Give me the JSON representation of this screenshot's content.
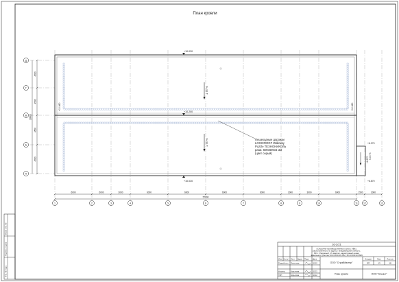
{
  "title": "План кровли",
  "columns": [
    "1",
    "2",
    "3",
    "4",
    "5",
    "6",
    "7",
    "8",
    "9",
    "10",
    "11",
    "12",
    "13"
  ],
  "rows": [
    "Д",
    "Г",
    "В",
    "Б",
    "А"
  ],
  "bay_dims": [
    "6000",
    "6000",
    "3000",
    "6000",
    "6000",
    "6000",
    "6000",
    "3000",
    "3000",
    "6000",
    "1500",
    "3000"
  ],
  "overall_length": "57000",
  "row_dims": [
    "4500",
    "4500",
    "4500",
    "4500"
  ],
  "overall_width": "18000",
  "levels": {
    "top_ridge": "+10.030",
    "mid_ridge": "+10.200",
    "bottom_eave": "+10.030",
    "left_mid": "+10.660",
    "right_mid": "+10.660",
    "annex_top": "+6.270",
    "annex_right": "+6.270",
    "annex_bottom": "+6.870"
  },
  "slopes": {
    "upper": "1.75 %",
    "lower": "1.75 %",
    "annex": "5.00 %"
  },
  "note_lines": [
    "Пешеходные дорожки",
    "LOGICROOF Walkway",
    "Puzzle ТЕХНОНИКОЛЬ",
    "разм. 600х600х6 мм",
    "(цвет серый)"
  ],
  "title_block": {
    "code": "16-2/21",
    "description_lines": [
      "«Сборочно-производственного цеха с АБК»,",
      "расположенного по адресу: Владимирская область,",
      "МО г. Радужный, 17 квартал, кадастровый номер",
      "земельного участка 33:23:000101:652, 33:23:000101:689"
    ],
    "header": [
      "Изм.",
      "Кол.уч",
      "Лист",
      "№док.",
      "Подп.",
      "Дата"
    ],
    "people": [
      {
        "role": "Разработал",
        "name": "Решетова",
        "date": "02.22"
      },
      {
        "role": "",
        "name": "",
        "date": ""
      },
      {
        "role": "Н.контр.",
        "name": "Корытова",
        "date": "02.22"
      },
      {
        "role": "ГИП",
        "name": "Корытова",
        "date": "02.22"
      }
    ],
    "organization": "ООО \"СтройМастер\"",
    "stage_header": [
      "Стадия",
      "Лист",
      "Листов"
    ],
    "stage": "ЭП",
    "sheet": "13",
    "sheets": "18",
    "drawing_name": "План кровли",
    "company": "ООО \"Альянс\""
  },
  "stamp_left": [
    "Взам. инв. №",
    "Подпись и дата",
    "Инв. № подл."
  ]
}
